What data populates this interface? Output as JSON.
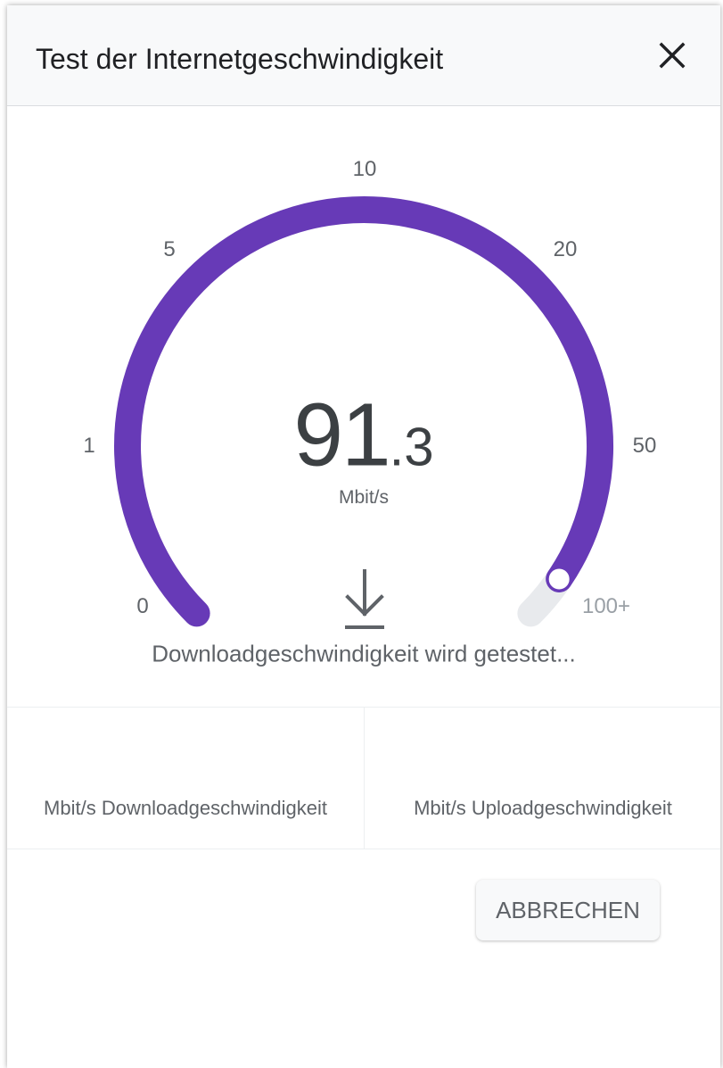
{
  "dialog": {
    "title": "Test der Internetgeschwindigkeit",
    "close_icon": "close-icon"
  },
  "gauge": {
    "ticks": [
      "0",
      "1",
      "5",
      "10",
      "20",
      "50",
      "100+"
    ],
    "fill_fraction": 0.96,
    "value_integer": "91",
    "value_decimal": ".3",
    "unit": "Mbit/s",
    "status": "Downloadgeschwindigkeit wird getestet...",
    "arrow_icon": "download-arrow-icon",
    "accent_color": "#673ab7",
    "track_color": "#e8eaed"
  },
  "results": {
    "download_label": "Mbit/s Downloadgeschwindigkeit",
    "upload_label": "Mbit/s Uploadgeschwindigkeit"
  },
  "actions": {
    "cancel_label": "ABBRECHEN"
  }
}
